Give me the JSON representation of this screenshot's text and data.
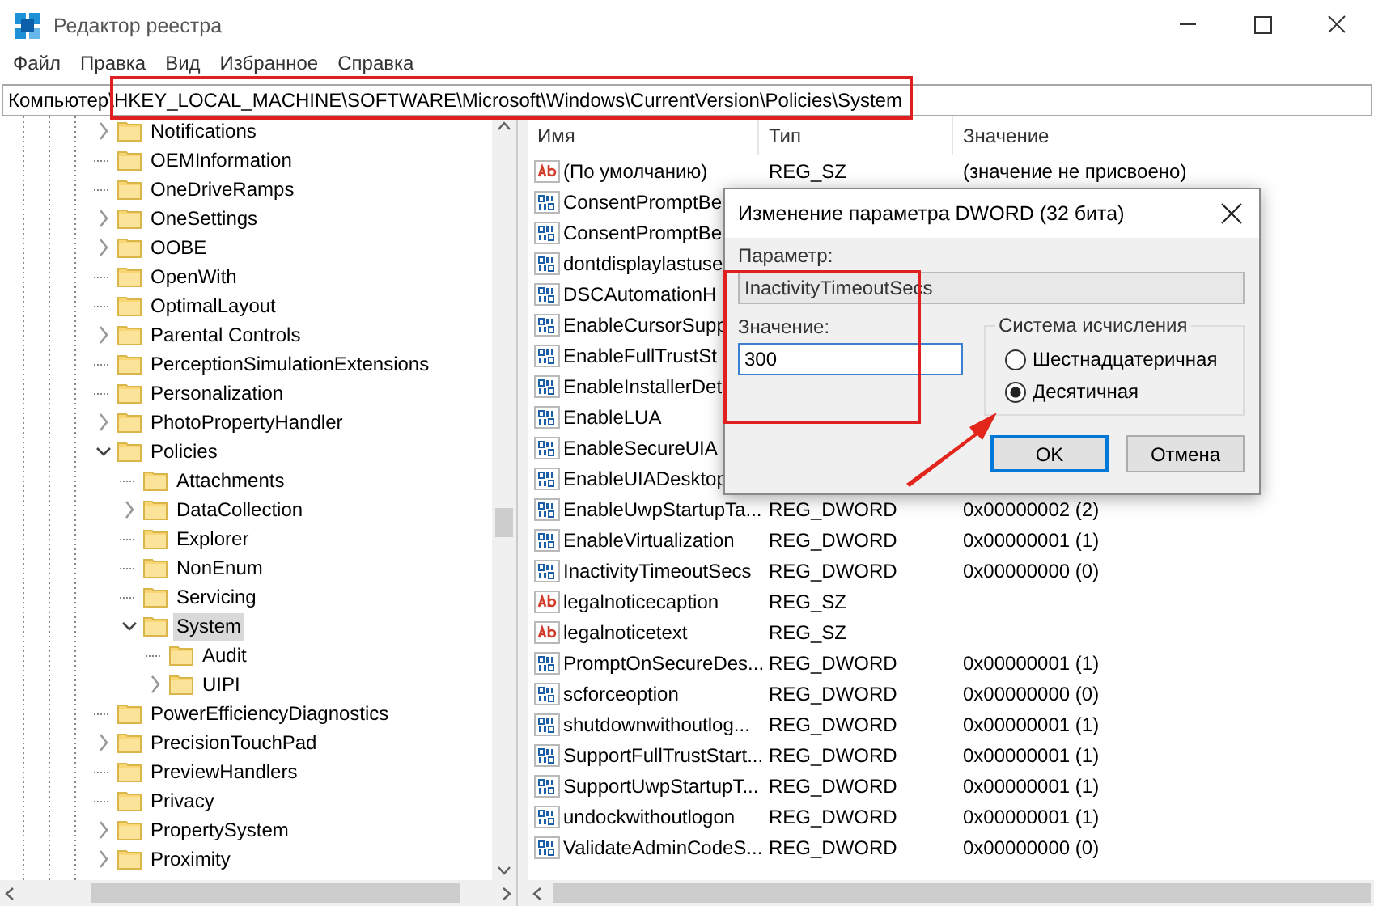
{
  "window": {
    "title": "Редактор реестра"
  },
  "menu": [
    "Файл",
    "Правка",
    "Вид",
    "Избранное",
    "Справка"
  ],
  "address": "Компьютер\\HKEY_LOCAL_MACHINE\\SOFTWARE\\Microsoft\\Windows\\CurrentVersion\\Policies\\System",
  "tree": [
    {
      "label": "Notifications",
      "has_children": true,
      "expanded": false,
      "selected": false
    },
    {
      "label": "OEMInformation",
      "has_children": false,
      "selected": false
    },
    {
      "label": "OneDriveRamps",
      "has_children": false,
      "selected": false
    },
    {
      "label": "OneSettings",
      "has_children": true,
      "expanded": false,
      "selected": false
    },
    {
      "label": "OOBE",
      "has_children": true,
      "expanded": false,
      "selected": false
    },
    {
      "label": "OpenWith",
      "has_children": false,
      "selected": false
    },
    {
      "label": "OptimalLayout",
      "has_children": false,
      "selected": false
    },
    {
      "label": "Parental Controls",
      "has_children": true,
      "expanded": false,
      "selected": false
    },
    {
      "label": "PerceptionSimulationExtensions",
      "has_children": false,
      "selected": false
    },
    {
      "label": "Personalization",
      "has_children": false,
      "selected": false
    },
    {
      "label": "PhotoPropertyHandler",
      "has_children": true,
      "expanded": false,
      "selected": false
    },
    {
      "label": "Policies",
      "has_children": true,
      "expanded": true,
      "selected": false,
      "children": [
        {
          "label": "Attachments",
          "has_children": false,
          "selected": false
        },
        {
          "label": "DataCollection",
          "has_children": true,
          "expanded": false,
          "selected": false
        },
        {
          "label": "Explorer",
          "has_children": false,
          "selected": false
        },
        {
          "label": "NonEnum",
          "has_children": false,
          "selected": false
        },
        {
          "label": "Servicing",
          "has_children": false,
          "selected": false
        },
        {
          "label": "System",
          "has_children": true,
          "expanded": true,
          "selected": true,
          "children": [
            {
              "label": "Audit",
              "has_children": false,
              "selected": false
            },
            {
              "label": "UIPI",
              "has_children": true,
              "expanded": false,
              "selected": false
            }
          ]
        }
      ]
    },
    {
      "label": "PowerEfficiencyDiagnostics",
      "has_children": false,
      "selected": false
    },
    {
      "label": "PrecisionTouchPad",
      "has_children": true,
      "expanded": false,
      "selected": false
    },
    {
      "label": "PreviewHandlers",
      "has_children": false,
      "selected": false
    },
    {
      "label": "Privacy",
      "has_children": false,
      "selected": false
    },
    {
      "label": "PropertySystem",
      "has_children": true,
      "expanded": false,
      "selected": false
    },
    {
      "label": "Proximity",
      "has_children": true,
      "expanded": false,
      "selected": false
    }
  ],
  "list": {
    "columns": [
      "Имя",
      "Тип",
      "Значение"
    ],
    "rows": [
      {
        "kind": "string",
        "name": "(По умолчанию)",
        "type": "REG_SZ",
        "value": "(значение не присвоено)"
      },
      {
        "kind": "dword",
        "name": "ConsentPromptBe"
      },
      {
        "kind": "dword",
        "name": "ConsentPromptBe"
      },
      {
        "kind": "dword",
        "name": "dontdisplaylastuse"
      },
      {
        "kind": "dword",
        "name": "DSCAutomationH"
      },
      {
        "kind": "dword",
        "name": "EnableCursorSupp"
      },
      {
        "kind": "dword",
        "name": "EnableFullTrustSt"
      },
      {
        "kind": "dword",
        "name": "EnableInstallerDet"
      },
      {
        "kind": "dword",
        "name": "EnableLUA"
      },
      {
        "kind": "dword",
        "name": "EnableSecureUIA"
      },
      {
        "kind": "dword",
        "name": "EnableUIADesktop"
      },
      {
        "kind": "dword",
        "name": "EnableUwpStartupTa...",
        "type": "REG_DWORD",
        "value": "0x00000002 (2)"
      },
      {
        "kind": "dword",
        "name": "EnableVirtualization",
        "type": "REG_DWORD",
        "value": "0x00000001 (1)"
      },
      {
        "kind": "dword",
        "name": "InactivityTimeoutSecs",
        "type": "REG_DWORD",
        "value": "0x00000000 (0)"
      },
      {
        "kind": "string",
        "name": "legalnoticecaption",
        "type": "REG_SZ"
      },
      {
        "kind": "string",
        "name": "legalnoticetext",
        "type": "REG_SZ"
      },
      {
        "kind": "dword",
        "name": "PromptOnSecureDes...",
        "type": "REG_DWORD",
        "value": "0x00000001 (1)"
      },
      {
        "kind": "dword",
        "name": "scforceoption",
        "type": "REG_DWORD",
        "value": "0x00000000 (0)"
      },
      {
        "kind": "dword",
        "name": "shutdownwithoutlog...",
        "type": "REG_DWORD",
        "value": "0x00000001 (1)"
      },
      {
        "kind": "dword",
        "name": "SupportFullTrustStart...",
        "type": "REG_DWORD",
        "value": "0x00000001 (1)"
      },
      {
        "kind": "dword",
        "name": "SupportUwpStartupT...",
        "type": "REG_DWORD",
        "value": "0x00000001 (1)"
      },
      {
        "kind": "dword",
        "name": "undockwithoutlogon",
        "type": "REG_DWORD",
        "value": "0x00000001 (1)"
      },
      {
        "kind": "dword",
        "name": "ValidateAdminCodeS...",
        "type": "REG_DWORD",
        "value": "0x00000000 (0)"
      }
    ]
  },
  "dialog": {
    "title": "Изменение параметра DWORD (32 бита)",
    "param_label": "Параметр:",
    "param_value": "InactivityTimeoutSecs",
    "param_disabled": true,
    "value_label": "Значение:",
    "value": "300",
    "base_legend": "Система исчисления",
    "bases": [
      {
        "label": "Шестнадцатеричная",
        "selected": false
      },
      {
        "label": "Десятичная",
        "selected": true
      }
    ],
    "buttons": [
      {
        "label": "OK",
        "default": true
      },
      {
        "label": "Отмена",
        "default": false
      }
    ]
  }
}
